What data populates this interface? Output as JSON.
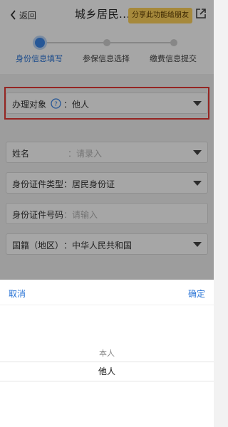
{
  "header": {
    "back_label": "返回",
    "title": "城乡居民...",
    "share_label": "分享此功能给朋友"
  },
  "steps": [
    {
      "label": "身份信息填写",
      "active": true
    },
    {
      "label": "参保信息选择",
      "active": false
    },
    {
      "label": "缴费信息提交",
      "active": false
    }
  ],
  "form": {
    "handler": {
      "label": "办理对象",
      "value": "：他人"
    },
    "name": {
      "label": "姓名",
      "placeholder": "：请录入"
    },
    "id_type": {
      "label": "身份证件类型",
      "value": "：居民身份证"
    },
    "id_number": {
      "label": "身份证件号码",
      "placeholder": "：请输入"
    },
    "nationality": {
      "label": "国籍（地区）",
      "value": "：中华人民共和国"
    }
  },
  "picker": {
    "cancel_label": "取消",
    "confirm_label": "确定",
    "options": [
      "本人",
      "他人"
    ],
    "selected": "他人"
  },
  "colors": {
    "accent": "#2a74d6",
    "highlight_border": "#e53935",
    "share_bg": "#ffd35c"
  }
}
